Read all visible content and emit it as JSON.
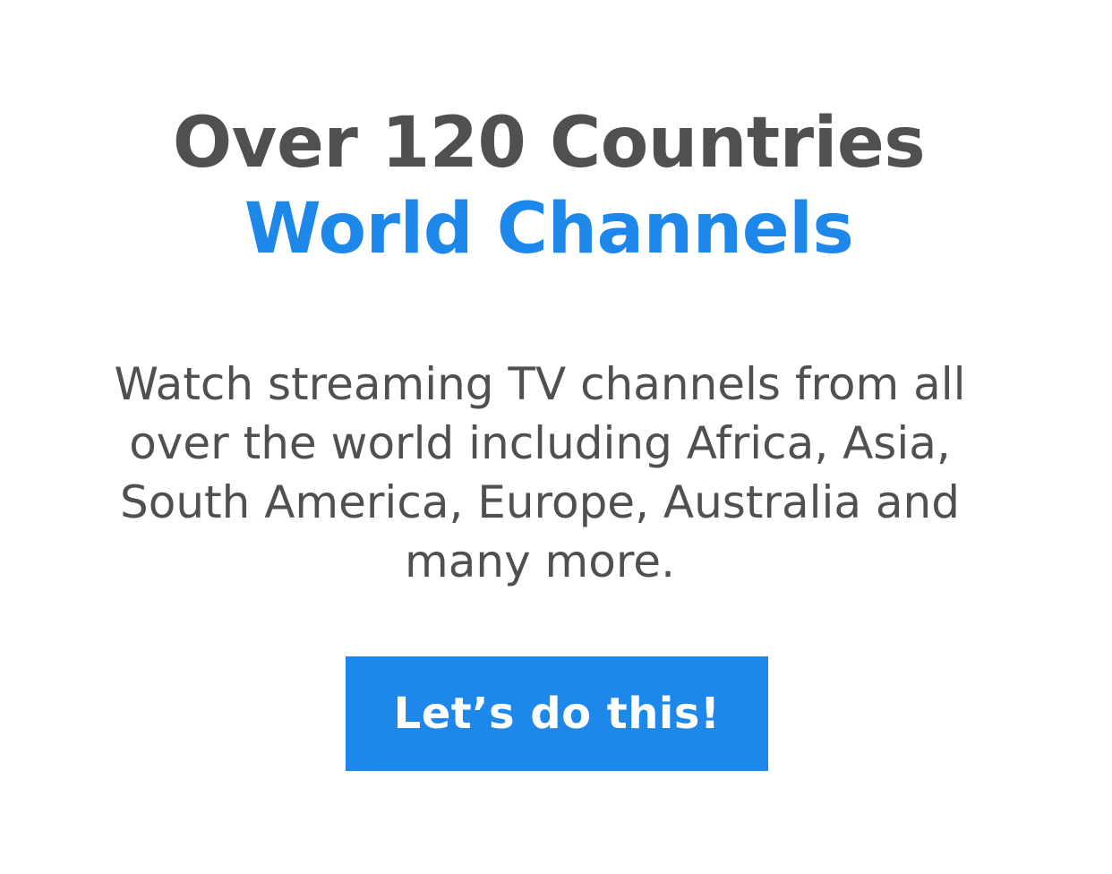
{
  "headline": {
    "line1": "Over 120 Countries",
    "line2": "World Channels"
  },
  "description": "Watch streaming TV channels from all over the world including Africa, Asia, South America, Europe, Australia and many more.",
  "cta": {
    "label": "Let’s do this!"
  },
  "colors": {
    "text_dark": "#505050",
    "accent": "#1e87ea",
    "background": "#ffffff",
    "button_text": "#ffffff"
  }
}
